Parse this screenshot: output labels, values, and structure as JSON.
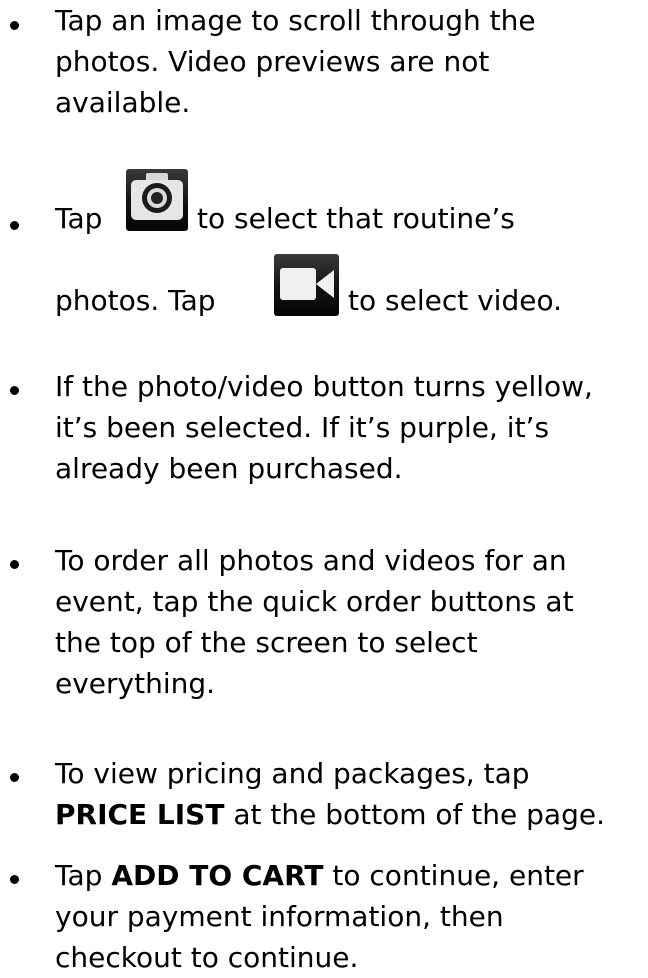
{
  "instructions": [
    {
      "lines": [
        "Tap an image to scroll through the",
        "photos.  Video previews are not",
        "available."
      ]
    },
    {
      "line1_before": "Tap",
      "line1_after": "to select that routine’s",
      "line2_before": "photos.  Tap",
      "line2_after": "to select video.",
      "icons": [
        "camera-icon",
        "video-camera-icon"
      ]
    },
    {
      "lines": [
        "If the photo/video button turns yellow,",
        "it’s been selected.  If it’s purple, it’s",
        "already been purchased."
      ]
    },
    {
      "lines": [
        "To order all photos and videos for an",
        "event, tap the quick order buttons at",
        "the top of the screen to select",
        "everything."
      ]
    },
    {
      "line1": "To view pricing and packages, tap",
      "bold": "PRICE LIST",
      "after_bold": "at the bottom of the page."
    },
    {
      "before_bold": "Tap",
      "bold": "ADD TO CART",
      "after_bold": "to continue, enter",
      "line2": "your payment information, then",
      "line3": "checkout to continue."
    }
  ]
}
